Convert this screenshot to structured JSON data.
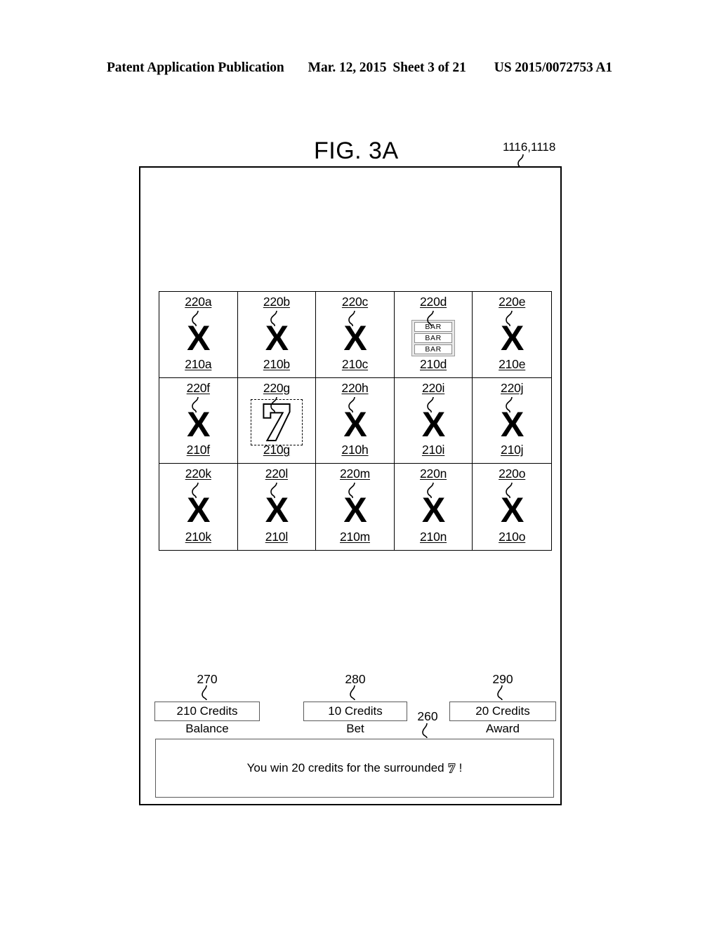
{
  "header": {
    "publication": "Patent Application Publication",
    "date": "Mar. 12, 2015",
    "sheet": "Sheet 3 of 21",
    "patent_number": "US 2015/0072753 A1"
  },
  "figure": {
    "title": "FIG. 3A",
    "device_reference": "1116,1118"
  },
  "grid": {
    "rows": 3,
    "columns": 5,
    "cells": [
      {
        "top_label": "220a",
        "bottom_label": "210a",
        "symbol": "x-symbol"
      },
      {
        "top_label": "220b",
        "bottom_label": "210b",
        "symbol": "x-symbol"
      },
      {
        "top_label": "220c",
        "bottom_label": "210c",
        "symbol": "x-symbol"
      },
      {
        "top_label": "220d",
        "bottom_label": "210d",
        "symbol": "triple-bar-symbol",
        "bar_labels": [
          "BAR",
          "BAR",
          "BAR"
        ]
      },
      {
        "top_label": "220e",
        "bottom_label": "210e",
        "symbol": "x-symbol"
      },
      {
        "top_label": "220f",
        "bottom_label": "210f",
        "symbol": "x-symbol"
      },
      {
        "top_label": "220g",
        "bottom_label": "210g",
        "symbol": "seven-symbol",
        "selected": true
      },
      {
        "top_label": "220h",
        "bottom_label": "210h",
        "symbol": "x-symbol"
      },
      {
        "top_label": "220i",
        "bottom_label": "210i",
        "symbol": "x-symbol"
      },
      {
        "top_label": "220j",
        "bottom_label": "210j",
        "symbol": "x-symbol"
      },
      {
        "top_label": "220k",
        "bottom_label": "210k",
        "symbol": "x-symbol"
      },
      {
        "top_label": "220l",
        "bottom_label": "210l",
        "symbol": "x-symbol"
      },
      {
        "top_label": "220m",
        "bottom_label": "210m",
        "symbol": "x-symbol"
      },
      {
        "top_label": "220n",
        "bottom_label": "210n",
        "symbol": "x-symbol"
      },
      {
        "top_label": "220o",
        "bottom_label": "210o",
        "symbol": "x-symbol"
      }
    ],
    "symbol_glyph_x": "X"
  },
  "meters": {
    "balance": {
      "value": "210 Credits",
      "caption": "Balance",
      "reference": "270"
    },
    "bet": {
      "value": "10 Credits",
      "caption": "Bet",
      "reference": "280"
    },
    "award": {
      "value": "20 Credits",
      "caption": "Award",
      "reference": "290"
    }
  },
  "message": {
    "reference": "260",
    "text_before": "You win 20 credits for the surrounded",
    "text_after": "!"
  }
}
